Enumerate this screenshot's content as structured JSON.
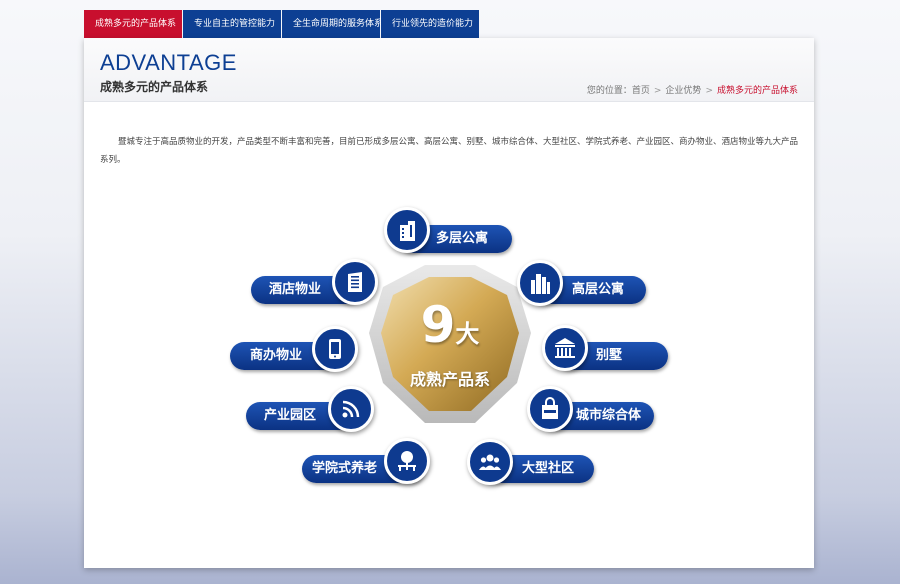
{
  "tabs": [
    {
      "label": "成熟多元的产品体系",
      "active": true
    },
    {
      "label": "专业自主的管控能力",
      "active": false
    },
    {
      "label": "全生命周期的服务体系",
      "active": false
    },
    {
      "label": "行业领先的造价能力",
      "active": false
    }
  ],
  "header": {
    "title": "ADVANTAGE",
    "subtitle": "成熟多元的产品体系"
  },
  "breadcrumb": {
    "prefix": "您的位置：",
    "home": "首页",
    "sep": ">",
    "section": "企业优势",
    "current": "成熟多元的产品体系"
  },
  "intro": "暨城专注于高品质物业的开发，产品类型不断丰富和完善，目前已形成多层公寓、高层公寓、别墅、城市综合体、大型社区、学院式养老、产业园区、商办物业、酒店物业等九大产品系列。",
  "center": {
    "number": "9",
    "unit": "大",
    "label": "成熟产品系"
  },
  "products": [
    {
      "label": "多层公寓",
      "icon": "building-icon"
    },
    {
      "label": "高层公寓",
      "icon": "highrise-icon"
    },
    {
      "label": "别墅",
      "icon": "villa-icon"
    },
    {
      "label": "城市综合体",
      "icon": "shopping-bag-icon"
    },
    {
      "label": "大型社区",
      "icon": "community-icon"
    },
    {
      "label": "学院式养老",
      "icon": "tree-bench-icon"
    },
    {
      "label": "产业园区",
      "icon": "wifi-icon"
    },
    {
      "label": "商办物业",
      "icon": "phone-icon"
    },
    {
      "label": "酒店物业",
      "icon": "hotel-icon"
    }
  ],
  "colors": {
    "navy": "#0d3f93",
    "accent_red": "#c80f2e",
    "gold": "#d4aa55"
  }
}
